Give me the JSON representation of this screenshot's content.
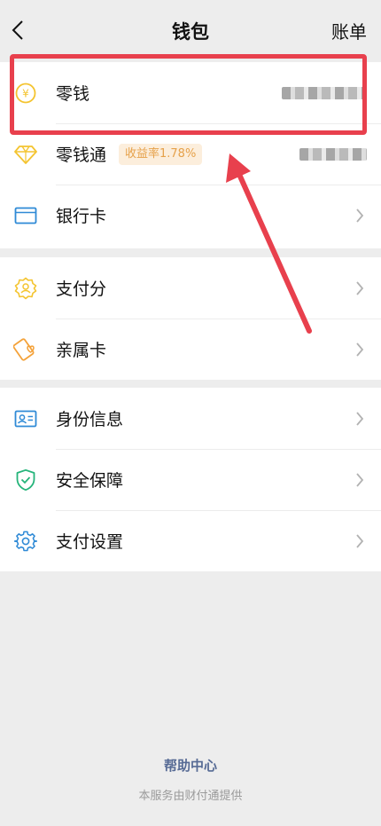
{
  "header": {
    "title": "钱包",
    "right_action": "账单"
  },
  "sections": [
    {
      "items": [
        {
          "label": "零钱",
          "icon": "change-coin-icon",
          "value_masked": true
        },
        {
          "label": "零钱通",
          "icon": "diamond-icon",
          "badge": "收益率1.78%",
          "value_masked": true
        },
        {
          "label": "银行卡",
          "icon": "bank-card-icon"
        }
      ]
    },
    {
      "items": [
        {
          "label": "支付分",
          "icon": "pay-score-icon"
        },
        {
          "label": "亲属卡",
          "icon": "family-card-icon"
        }
      ]
    },
    {
      "items": [
        {
          "label": "身份信息",
          "icon": "id-card-icon"
        },
        {
          "label": "安全保障",
          "icon": "shield-icon"
        },
        {
          "label": "支付设置",
          "icon": "gear-icon"
        }
      ]
    }
  ],
  "footer": {
    "help": "帮助中心",
    "provider": "本服务由财付通提供"
  },
  "colors": {
    "background": "#EDEDED",
    "annotation_red": "#E8404D",
    "link_blue": "#576B95",
    "badge_text": "#E6A14A",
    "badge_bg": "#FCEEDC",
    "icon_yellow": "#F4C430",
    "icon_blue": "#2F8AD6",
    "icon_green": "#25B47A"
  }
}
